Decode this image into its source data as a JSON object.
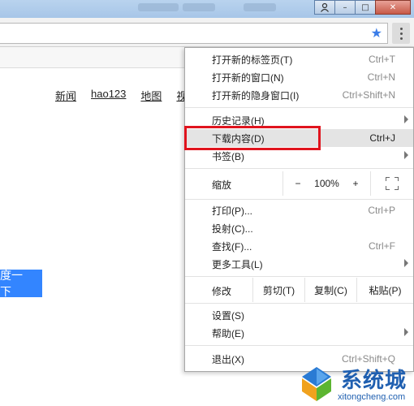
{
  "window": {
    "buttons": {
      "minimize": "–",
      "maximize": "□",
      "close": "✕"
    }
  },
  "page": {
    "nav_links": [
      "新闻",
      "hao123",
      "地图",
      "视"
    ],
    "search_button": "度一下"
  },
  "menu": {
    "new_tab": {
      "label": "打开新的标签页(T)",
      "shortcut": "Ctrl+T"
    },
    "new_window": {
      "label": "打开新的窗口(N)",
      "shortcut": "Ctrl+N"
    },
    "new_incognito": {
      "label": "打开新的隐身窗口(I)",
      "shortcut": "Ctrl+Shift+N"
    },
    "history": {
      "label": "历史记录(H)"
    },
    "downloads": {
      "label": "下载内容(D)",
      "shortcut": "Ctrl+J"
    },
    "bookmarks": {
      "label": "书签(B)"
    },
    "zoom": {
      "label": "缩放",
      "minus": "−",
      "value": "100%",
      "plus": "+"
    },
    "print": {
      "label": "打印(P)...",
      "shortcut": "Ctrl+P"
    },
    "cast": {
      "label": "投射(C)..."
    },
    "find": {
      "label": "查找(F)...",
      "shortcut": "Ctrl+F"
    },
    "more_tools": {
      "label": "更多工具(L)"
    },
    "edit": {
      "label": "修改",
      "cut": "剪切(T)",
      "copy": "复制(C)",
      "paste": "粘贴(P)"
    },
    "settings": {
      "label": "设置(S)"
    },
    "help": {
      "label": "帮助(E)"
    },
    "exit": {
      "label": "退出(X)",
      "shortcut": "Ctrl+Shift+Q"
    }
  },
  "watermark": {
    "title": "系统城",
    "url": "xitongcheng.com"
  },
  "colors": {
    "accent_blue": "#3385ff",
    "highlight_red": "#e0141e",
    "star_blue": "#3b7de8"
  }
}
